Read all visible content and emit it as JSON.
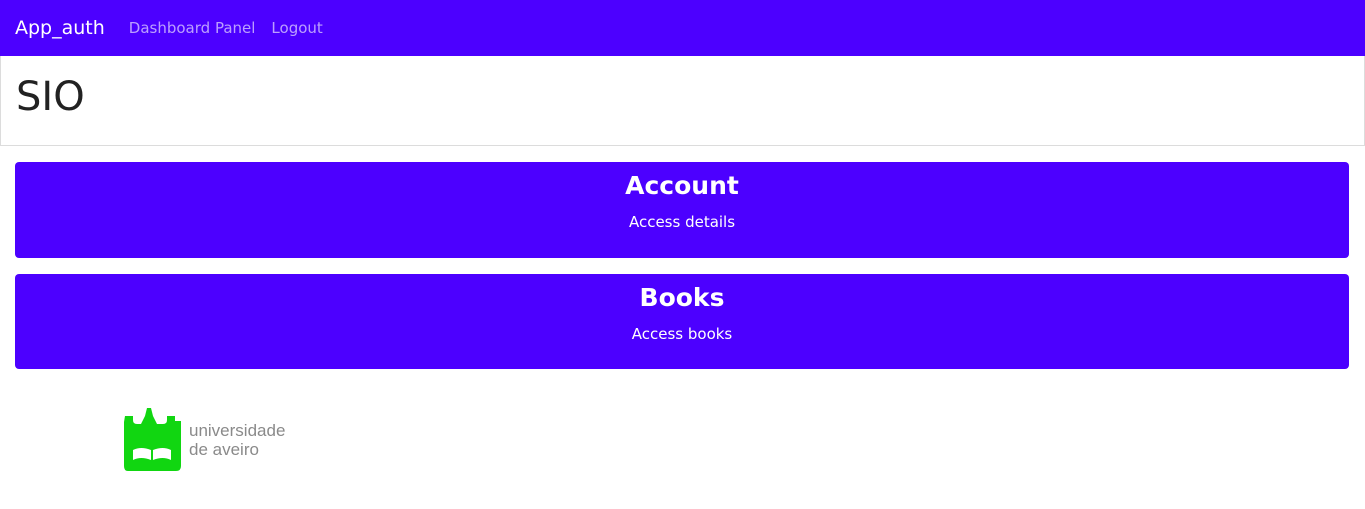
{
  "navbar": {
    "brand": "App_auth",
    "links": [
      "Dashboard Panel",
      "Logout"
    ]
  },
  "header": {
    "title": "SIO"
  },
  "cards": [
    {
      "title": "Account",
      "subtitle": "Access details"
    },
    {
      "title": "Books",
      "subtitle": "Access books"
    }
  ],
  "footer": {
    "logo_line1": "universidade",
    "logo_line2": "de aveiro",
    "logo_color": "#11d611"
  },
  "colors": {
    "primary": "#4c00ff",
    "text_dark": "#222222"
  }
}
